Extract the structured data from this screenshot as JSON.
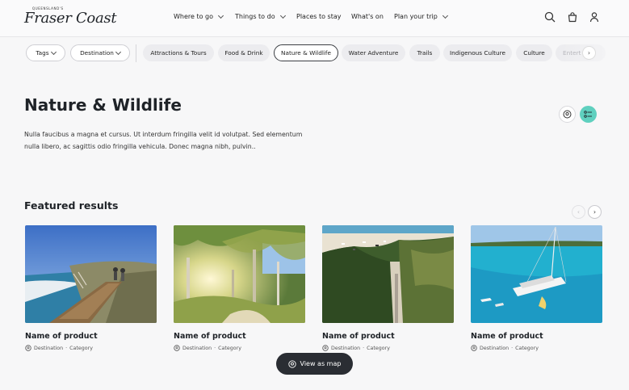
{
  "header": {
    "logo_small": "QUEENSLAND'S",
    "logo_script": "Fraser Coast",
    "nav": [
      {
        "label": "Where to go",
        "dropdown": true
      },
      {
        "label": "Things to do",
        "dropdown": true
      },
      {
        "label": "Places to stay",
        "dropdown": false
      },
      {
        "label": "What's on",
        "dropdown": false
      },
      {
        "label": "Plan your trip",
        "dropdown": true
      }
    ],
    "icons": [
      "search-icon",
      "bag-icon",
      "user-icon"
    ]
  },
  "filters": {
    "dropdowns": [
      "Tags",
      "Destination"
    ],
    "chips": [
      "Attractions & Tours",
      "Food & Drink",
      "Nature & Wildlife",
      "Water Adventure",
      "Trails",
      "Indigenous Culture",
      "Culture",
      "Entert"
    ],
    "active_chip": "Nature & Wildlife"
  },
  "page": {
    "title": "Nature & Wildlife",
    "description": "Nulla faucibus a magna et cursus. Ut interdum fringilla velit id volutpat. Sed elementum nulla libero, ac sagittis odio fringilla vehicula. Donec magna nibh, pulvin.."
  },
  "featured": {
    "title": "Featured results",
    "cards": [
      {
        "name": "Name of product",
        "destination": "Destination",
        "sep": "·",
        "category": "Category",
        "image": "boardwalk-coast"
      },
      {
        "name": "Name of product",
        "destination": "Destination",
        "sep": "·",
        "category": "Category",
        "image": "eucalyptus-forest"
      },
      {
        "name": "Name of product",
        "destination": "Destination",
        "sep": "·",
        "category": "Category",
        "image": "beach-aerial"
      },
      {
        "name": "Name of product",
        "destination": "Destination",
        "sep": "·",
        "category": "Category",
        "image": "catamaran-lagoon"
      }
    ]
  },
  "map_button": {
    "label": "View as map"
  },
  "colors": {
    "accent": "#5fd0bf",
    "dark_button": "#2a2d33",
    "background": "#f7f7f8"
  }
}
